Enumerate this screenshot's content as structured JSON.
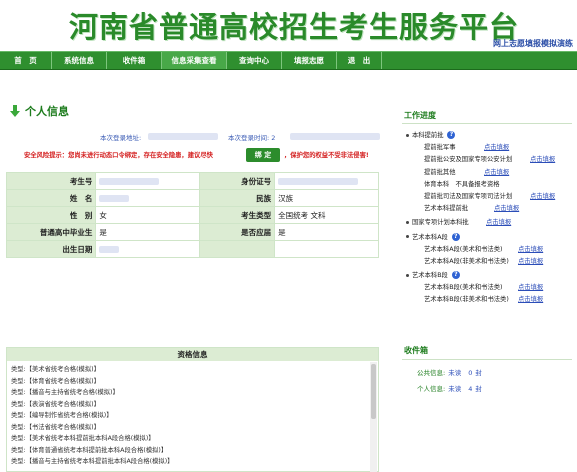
{
  "header": {
    "title": "河南省普通高校招生考生服务平台",
    "mock_tag": "网上志愿填报模拟演练"
  },
  "nav": [
    "首　页",
    "系统信息",
    "收件箱",
    "信息采集查看",
    "查询中心",
    "填报志愿",
    "退　出"
  ],
  "profile": {
    "section_title": "个人信息",
    "last_login_addr_label": "本次登录地址:",
    "last_login_time_label": "本次登录时间: 2",
    "warning_left": "安全风险提示：您尚未进行动态口令绑定，存在安全隐患，建议尽快",
    "bind_button": "绑 定",
    "warning_right": "，保护您的权益不受非法侵害!",
    "rows": [
      {
        "l1": "考生号",
        "v1": "",
        "l2": "身份证号",
        "v2": ""
      },
      {
        "l1": "姓　名",
        "v1": "",
        "l2": "民族",
        "v2": "汉族"
      },
      {
        "l1": "性　别",
        "v1": "女",
        "l2": "考生类型",
        "v2": "全国统考 文科"
      },
      {
        "l1": "普通高中毕业生",
        "v1": "是",
        "l2": "是否应届",
        "v2": "是"
      },
      {
        "l1": "出生日期",
        "v1": "",
        "l2": "",
        "v2": ""
      }
    ]
  },
  "qualifications": {
    "header": "资格信息",
    "items": [
      "类型:【美术省统考合格(模拟)】",
      "类型:【体育省统考合格(模拟)】",
      "类型:【播音与主持省统考合格(模拟)】",
      "类型:【表演省统考合格(模拟)】",
      "类型:【编导制作省统考合格(模拟)】",
      "类型:【书法省统考合格(模拟)】",
      "类型:【美术省统考本科提前批本科A段合格(模拟)】",
      "类型:【体育普通省统考本科提前批本科A段合格(模拟)】",
      "类型:【播音与主持省统考本科提前批本科A段合格(模拟)】"
    ]
  },
  "progress": {
    "title": "工作进度",
    "apply_label": "点击填报",
    "nodes": [
      {
        "text": "本科提前批",
        "level": 1,
        "help": true,
        "link": false
      },
      {
        "text": "提前批军事",
        "level": 2,
        "help": false,
        "link": true
      },
      {
        "text": "提前批公安及国家专项公安计划",
        "level": 2,
        "help": false,
        "link": true
      },
      {
        "text": "提前批其他",
        "level": 2,
        "help": false,
        "link": true
      },
      {
        "text": "体育本科　不具备报考资格",
        "level": 2,
        "help": false,
        "link": false
      },
      {
        "text": "提前批司法及国家专项司法计划",
        "level": 2,
        "help": false,
        "link": true
      },
      {
        "text": "艺术本科提前批",
        "level": 2,
        "help": false,
        "link": true
      },
      {
        "text": "国家专项计划本科批",
        "level": 1,
        "help": false,
        "link": true
      },
      {
        "text": "艺术本科A段",
        "level": 1,
        "help": true,
        "link": false
      },
      {
        "text": "艺术本科A段(美术和书法类)",
        "level": 2,
        "help": false,
        "link": true
      },
      {
        "text": "艺术本科A段(非美术和书法类)",
        "level": 2,
        "help": false,
        "link": true
      },
      {
        "text": "艺术本科B段",
        "level": 1,
        "help": true,
        "link": false
      },
      {
        "text": "艺术本科B段(美术和书法类)",
        "level": 2,
        "help": false,
        "link": true
      },
      {
        "text": "艺术本科B段(非美术和书法类)",
        "level": 2,
        "help": false,
        "link": true
      }
    ]
  },
  "inbox": {
    "title": "收件箱",
    "rows": [
      {
        "label": "公共信息:",
        "unread": "未读",
        "count": "0",
        "unit": "封"
      },
      {
        "label": "个人信息:",
        "unread": "未读",
        "count": "4",
        "unit": "封"
      }
    ]
  }
}
